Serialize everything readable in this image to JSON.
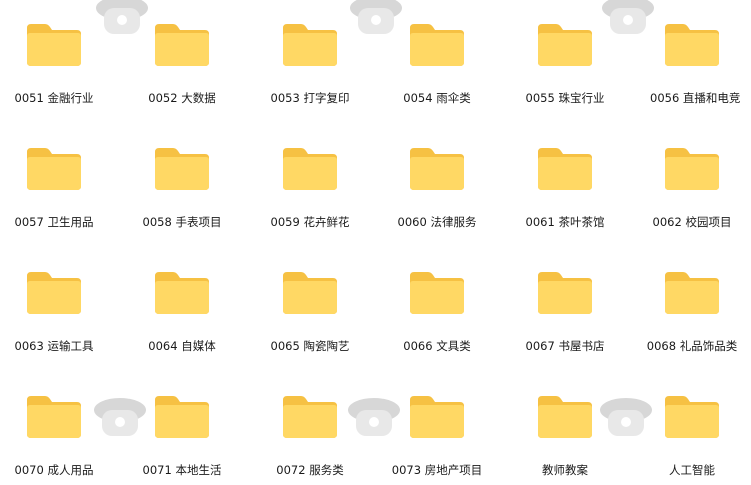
{
  "folders": [
    {
      "label": "0051 金融行业"
    },
    {
      "label": "0052 大数据"
    },
    {
      "label": "0053 打字复印"
    },
    {
      "label": "0054 雨伞类"
    },
    {
      "label": "0055 珠宝行业"
    },
    {
      "label": "0056 直播和电竞"
    },
    {
      "label": "0057 卫生用品"
    },
    {
      "label": "0058 手表项目"
    },
    {
      "label": "0059 花卉鲜花"
    },
    {
      "label": "0060 法律服务"
    },
    {
      "label": "0061 茶叶茶馆"
    },
    {
      "label": "0062 校园项目"
    },
    {
      "label": "0063 运输工具"
    },
    {
      "label": "0064 自媒体"
    },
    {
      "label": "0065 陶瓷陶艺"
    },
    {
      "label": "0066 文具类"
    },
    {
      "label": "0067 书屋书店"
    },
    {
      "label": "0068 礼品饰品类"
    },
    {
      "label": "0070 成人用品"
    },
    {
      "label": "0071 本地生活"
    },
    {
      "label": "0072 服务类"
    },
    {
      "label": "0073 房地产项目"
    },
    {
      "label": "教师教案"
    },
    {
      "label": "人工智能"
    }
  ],
  "colors": {
    "folder_body": "#FFD864",
    "folder_back": "#F6C143",
    "label_text": "#1a1a1a",
    "background": "#ffffff"
  },
  "icons": {
    "folder": "folder-icon",
    "watermark": "ghost-watermark-icon"
  }
}
